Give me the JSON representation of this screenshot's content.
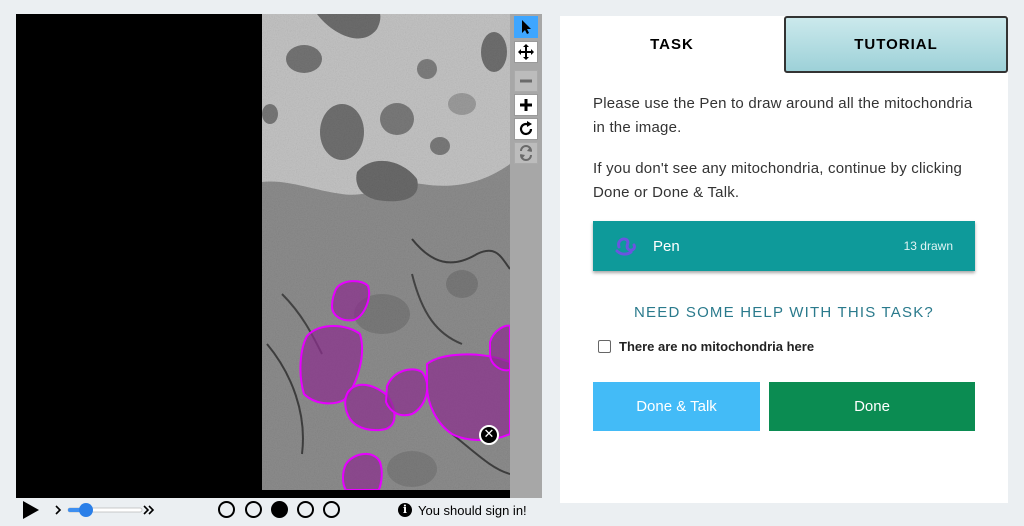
{
  "viewer": {
    "tools": [
      "pointer-icon",
      "move-icon",
      "zoom-out-icon",
      "zoom-in-icon",
      "rotate-icon",
      "reset-icon"
    ],
    "active_tool": "pointer-icon",
    "close_glyph": "✕"
  },
  "controls": {
    "frames": 5,
    "active_frame": 3,
    "signin_icon": "i",
    "signin_text": "You should sign in!"
  },
  "panel": {
    "tabs": {
      "task": "TASK",
      "tutorial": "TUTORIAL"
    },
    "instruction": "Please use the Pen to draw around all the mitochondria in the image.",
    "instruction2": "If you don't see any mitochondria, continue by clicking Done or Done & Talk.",
    "tool": {
      "label": "Pen",
      "count": "13 drawn"
    },
    "help": "NEED SOME HELP WITH THIS TASK?",
    "checkbox_label": "There are no mitochondria here",
    "buttons": {
      "talk": "Done & Talk",
      "done": "Done"
    }
  },
  "colors": {
    "tool_active": "#3ea6ff",
    "pen_bg": "#0e9a9a",
    "done": "#0b8c52",
    "talk": "#43bbf7",
    "annotation": "#e600ff"
  }
}
